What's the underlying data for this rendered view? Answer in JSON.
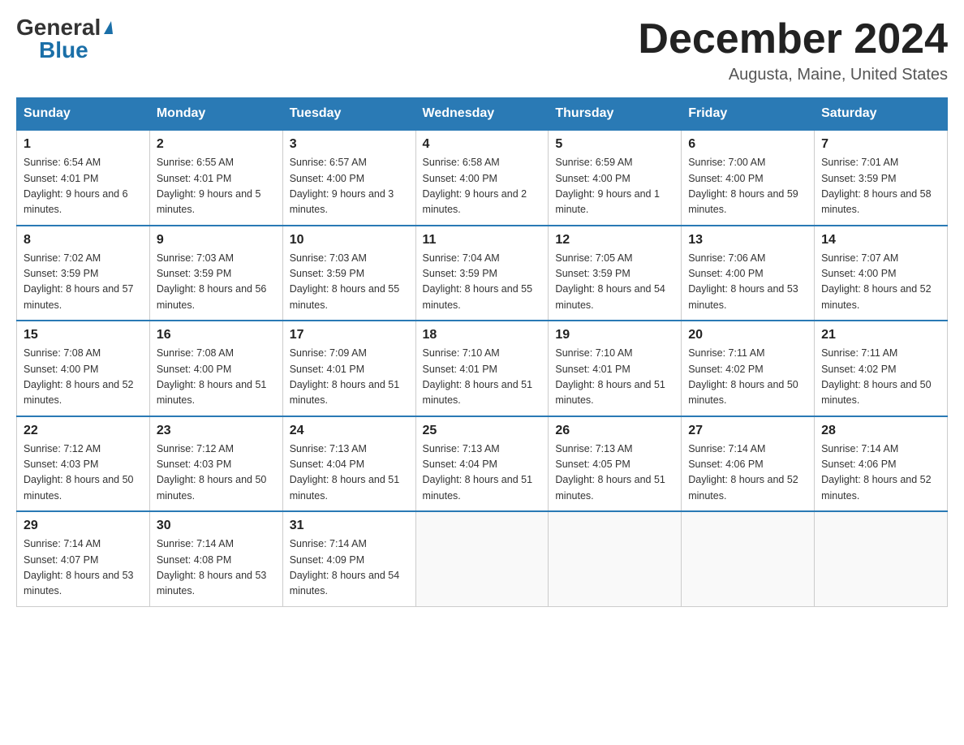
{
  "logo": {
    "general": "General",
    "blue": "Blue",
    "triangle": "▲"
  },
  "title": "December 2024",
  "subtitle": "Augusta, Maine, United States",
  "weekdays": [
    "Sunday",
    "Monday",
    "Tuesday",
    "Wednesday",
    "Thursday",
    "Friday",
    "Saturday"
  ],
  "weeks": [
    [
      {
        "day": "1",
        "sunrise": "6:54 AM",
        "sunset": "4:01 PM",
        "daylight": "9 hours and 6 minutes."
      },
      {
        "day": "2",
        "sunrise": "6:55 AM",
        "sunset": "4:01 PM",
        "daylight": "9 hours and 5 minutes."
      },
      {
        "day": "3",
        "sunrise": "6:57 AM",
        "sunset": "4:00 PM",
        "daylight": "9 hours and 3 minutes."
      },
      {
        "day": "4",
        "sunrise": "6:58 AM",
        "sunset": "4:00 PM",
        "daylight": "9 hours and 2 minutes."
      },
      {
        "day": "5",
        "sunrise": "6:59 AM",
        "sunset": "4:00 PM",
        "daylight": "9 hours and 1 minute."
      },
      {
        "day": "6",
        "sunrise": "7:00 AM",
        "sunset": "4:00 PM",
        "daylight": "8 hours and 59 minutes."
      },
      {
        "day": "7",
        "sunrise": "7:01 AM",
        "sunset": "3:59 PM",
        "daylight": "8 hours and 58 minutes."
      }
    ],
    [
      {
        "day": "8",
        "sunrise": "7:02 AM",
        "sunset": "3:59 PM",
        "daylight": "8 hours and 57 minutes."
      },
      {
        "day": "9",
        "sunrise": "7:03 AM",
        "sunset": "3:59 PM",
        "daylight": "8 hours and 56 minutes."
      },
      {
        "day": "10",
        "sunrise": "7:03 AM",
        "sunset": "3:59 PM",
        "daylight": "8 hours and 55 minutes."
      },
      {
        "day": "11",
        "sunrise": "7:04 AM",
        "sunset": "3:59 PM",
        "daylight": "8 hours and 55 minutes."
      },
      {
        "day": "12",
        "sunrise": "7:05 AM",
        "sunset": "3:59 PM",
        "daylight": "8 hours and 54 minutes."
      },
      {
        "day": "13",
        "sunrise": "7:06 AM",
        "sunset": "4:00 PM",
        "daylight": "8 hours and 53 minutes."
      },
      {
        "day": "14",
        "sunrise": "7:07 AM",
        "sunset": "4:00 PM",
        "daylight": "8 hours and 52 minutes."
      }
    ],
    [
      {
        "day": "15",
        "sunrise": "7:08 AM",
        "sunset": "4:00 PM",
        "daylight": "8 hours and 52 minutes."
      },
      {
        "day": "16",
        "sunrise": "7:08 AM",
        "sunset": "4:00 PM",
        "daylight": "8 hours and 51 minutes."
      },
      {
        "day": "17",
        "sunrise": "7:09 AM",
        "sunset": "4:01 PM",
        "daylight": "8 hours and 51 minutes."
      },
      {
        "day": "18",
        "sunrise": "7:10 AM",
        "sunset": "4:01 PM",
        "daylight": "8 hours and 51 minutes."
      },
      {
        "day": "19",
        "sunrise": "7:10 AM",
        "sunset": "4:01 PM",
        "daylight": "8 hours and 51 minutes."
      },
      {
        "day": "20",
        "sunrise": "7:11 AM",
        "sunset": "4:02 PM",
        "daylight": "8 hours and 50 minutes."
      },
      {
        "day": "21",
        "sunrise": "7:11 AM",
        "sunset": "4:02 PM",
        "daylight": "8 hours and 50 minutes."
      }
    ],
    [
      {
        "day": "22",
        "sunrise": "7:12 AM",
        "sunset": "4:03 PM",
        "daylight": "8 hours and 50 minutes."
      },
      {
        "day": "23",
        "sunrise": "7:12 AM",
        "sunset": "4:03 PM",
        "daylight": "8 hours and 50 minutes."
      },
      {
        "day": "24",
        "sunrise": "7:13 AM",
        "sunset": "4:04 PM",
        "daylight": "8 hours and 51 minutes."
      },
      {
        "day": "25",
        "sunrise": "7:13 AM",
        "sunset": "4:04 PM",
        "daylight": "8 hours and 51 minutes."
      },
      {
        "day": "26",
        "sunrise": "7:13 AM",
        "sunset": "4:05 PM",
        "daylight": "8 hours and 51 minutes."
      },
      {
        "day": "27",
        "sunrise": "7:14 AM",
        "sunset": "4:06 PM",
        "daylight": "8 hours and 52 minutes."
      },
      {
        "day": "28",
        "sunrise": "7:14 AM",
        "sunset": "4:06 PM",
        "daylight": "8 hours and 52 minutes."
      }
    ],
    [
      {
        "day": "29",
        "sunrise": "7:14 AM",
        "sunset": "4:07 PM",
        "daylight": "8 hours and 53 minutes."
      },
      {
        "day": "30",
        "sunrise": "7:14 AM",
        "sunset": "4:08 PM",
        "daylight": "8 hours and 53 minutes."
      },
      {
        "day": "31",
        "sunrise": "7:14 AM",
        "sunset": "4:09 PM",
        "daylight": "8 hours and 54 minutes."
      },
      null,
      null,
      null,
      null
    ]
  ]
}
